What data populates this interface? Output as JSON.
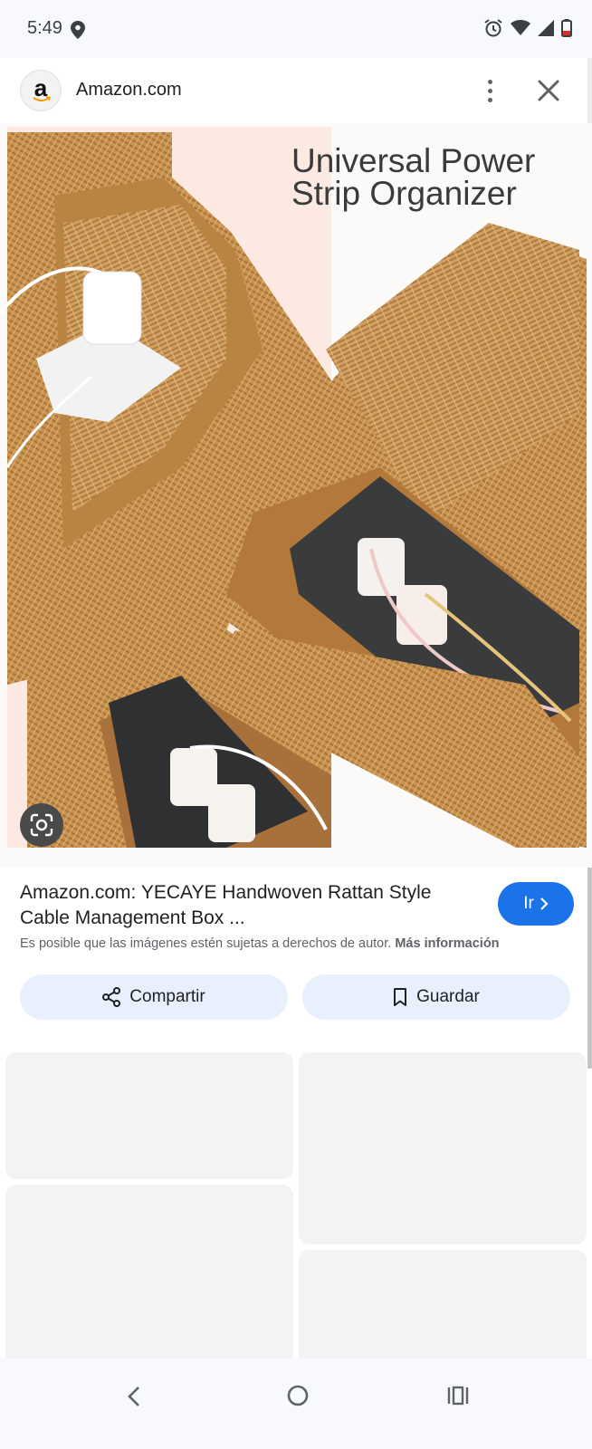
{
  "status_bar": {
    "time": "5:49",
    "icons": [
      "location-icon",
      "alarm-icon",
      "wifi-icon",
      "signal-icon",
      "battery-low-icon"
    ]
  },
  "header": {
    "logo_letter": "a",
    "site_name": "Amazon.com"
  },
  "image": {
    "overlay_text_line1": "Universal Power",
    "overlay_text_line2": "Strip Organizer"
  },
  "result": {
    "title": "Amazon.com: YECAYE Handwoven Rattan Style Cable Management Box ...",
    "visit_label": "Ir",
    "copyright_text": "Es posible que las imágenes estén sujetas a derechos de autor.",
    "more_info_label": "Más información"
  },
  "actions": {
    "share_label": "Compartir",
    "save_label": "Guardar"
  },
  "colors": {
    "accent": "#1a73e8",
    "action_bg": "#e8f0fe",
    "rattan": "#c9934f",
    "placeholder": "#f1f3f4"
  }
}
